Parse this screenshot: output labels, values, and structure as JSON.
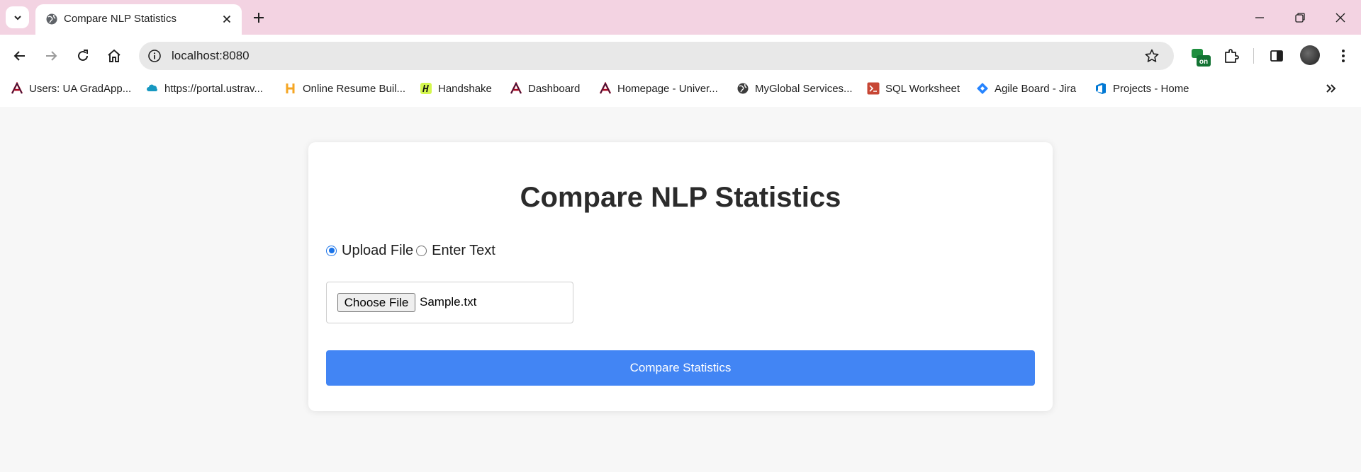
{
  "browser": {
    "tab": {
      "title": "Compare NLP Statistics"
    },
    "address": {
      "url": "localhost:8080"
    },
    "extensions": {
      "badge_text": "on"
    },
    "bookmarks": [
      {
        "label": "Users: UA GradApp...",
        "icon": "university-a-icon"
      },
      {
        "label": "https://portal.ustrav...",
        "icon": "cloud-icon"
      },
      {
        "label": "Online Resume Buil...",
        "icon": "h-logo-icon"
      },
      {
        "label": "Handshake",
        "icon": "handshake-icon"
      },
      {
        "label": "Dashboard",
        "icon": "university-a-icon"
      },
      {
        "label": "Homepage - Univer...",
        "icon": "university-a-icon"
      },
      {
        "label": "MyGlobal Services...",
        "icon": "globe-icon"
      },
      {
        "label": "SQL Worksheet",
        "icon": "terminal-icon"
      },
      {
        "label": "Agile Board - Jira",
        "icon": "jira-icon"
      },
      {
        "label": "Projects - Home",
        "icon": "devops-icon"
      }
    ]
  },
  "page": {
    "title": "Compare NLP Statistics",
    "input_mode": {
      "options": [
        {
          "label": "Upload File",
          "checked": true
        },
        {
          "label": "Enter Text",
          "checked": false
        }
      ]
    },
    "file_input": {
      "button_label": "Choose File",
      "file_name": "Sample.txt"
    },
    "submit_label": "Compare Statistics"
  },
  "colors": {
    "tabstrip_bg": "#f3d3e2",
    "accent_button": "#4285f4",
    "radio_selected": "#1a73e8",
    "page_bg": "#f7f7f7"
  }
}
